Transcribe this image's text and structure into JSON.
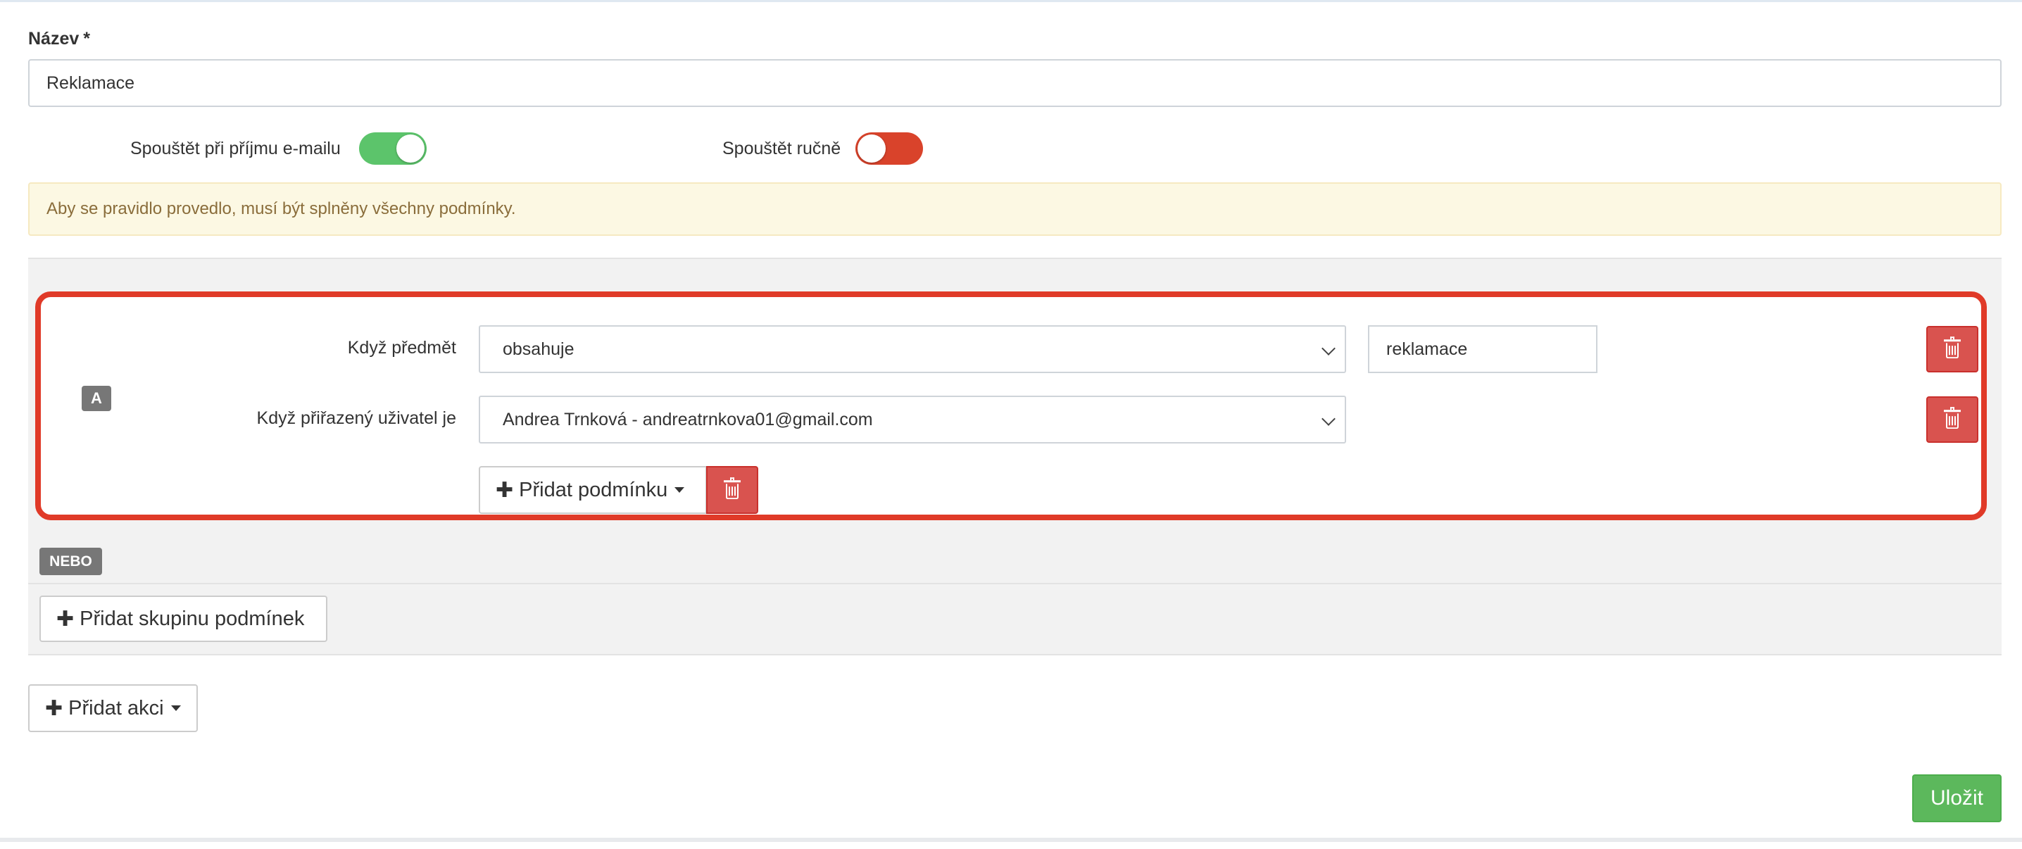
{
  "form": {
    "name_label": "Název",
    "required_mark": "*",
    "name_value": "Reklamace"
  },
  "toggles": [
    {
      "label": "Spouštět při příjmu e-mailu",
      "state": "on",
      "color": "#5cc46b"
    },
    {
      "label": "Spouštět ručně",
      "state": "off",
      "color": "#d9432b"
    }
  ],
  "alert": {
    "text": "Aby se pravidlo provedlo, musí být splněny všechny podmínky."
  },
  "condition_group": {
    "badge": "A",
    "highlight_color": "#e03a28",
    "rows": [
      {
        "label": "Když předmět",
        "operator": "obsahuje",
        "value": "reklamace",
        "delete_icon": "trash-icon"
      },
      {
        "label": "Když přiřazený uživatel je",
        "operator": "Andrea Trnková - andreatrnkova01@gmail.com",
        "delete_icon": "trash-icon"
      }
    ],
    "add_condition_label": "Přidat podmínku"
  },
  "or_badge": "NEBO",
  "add_group_label": "Přidat skupinu podmínek",
  "add_action_label": "Přidat akci",
  "save_label": "Uložit"
}
